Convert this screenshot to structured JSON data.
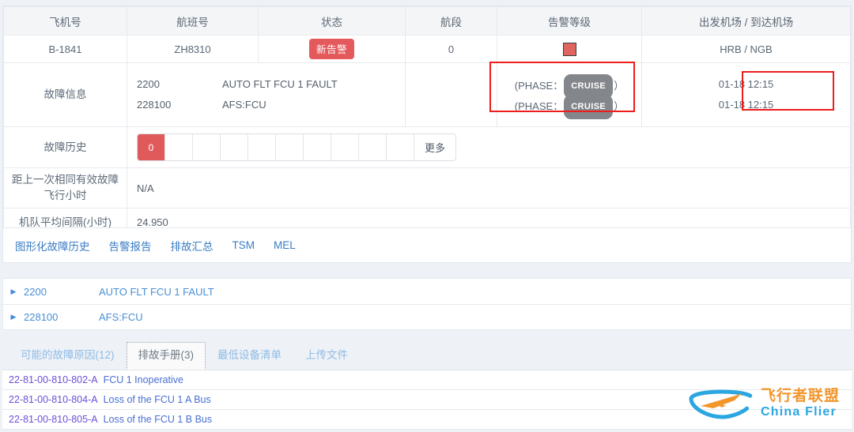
{
  "table": {
    "headers": [
      "飞机号",
      "航班号",
      "状态",
      "航段",
      "告警等级",
      "出发机场 / 到达机场"
    ],
    "main_row": {
      "aircraft": "B-1841",
      "flight": "ZH8310",
      "status_badge": "新告警",
      "leg": "0",
      "alarm_level_icon": "red-square-icon",
      "airports": "HRB / NGB"
    },
    "fault_info": {
      "label": "故障信息",
      "rows": [
        {
          "code": "2200",
          "desc": "AUTO FLT FCU 1 FAULT",
          "phase_prefix": "(PHASE：",
          "phase": "CRUISE",
          "phase_suffix": "）",
          "time": "01-18 12:15"
        },
        {
          "code": "228100",
          "desc": "AFS:FCU",
          "phase_prefix": "(PHASE：",
          "phase": "CRUISE",
          "phase_suffix": "）",
          "time": "01-18 12:15"
        }
      ]
    },
    "fault_history": {
      "label": "故障历史",
      "cells": [
        "0",
        "",
        "",
        "",
        "",
        "",
        "",
        "",
        "",
        ""
      ],
      "filled_index": 0,
      "more_label": "更多"
    },
    "last_same_fault": {
      "label": "距上一次相同有效故障飞行小时",
      "label_line1": "距上一次相同有效故障",
      "label_line2": "飞行小时",
      "value": "N/A"
    },
    "fleet_avg": {
      "label": "机队平均间隔(小时)",
      "value": "24.950"
    }
  },
  "linkbar": {
    "links": [
      "图形化故障历史",
      "告警报告",
      "排故汇总",
      "TSM",
      "MEL"
    ]
  },
  "accordion": {
    "rows": [
      {
        "code": "2200",
        "desc": "AUTO FLT FCU 1 FAULT"
      },
      {
        "code": "228100",
        "desc": "AFS:FCU"
      }
    ]
  },
  "bottom_tabs": {
    "tabs": [
      {
        "label": "可能的故障原因(12)",
        "active": false
      },
      {
        "label": "排故手册(3)",
        "active": true
      },
      {
        "label": "最低设备清单",
        "active": false
      },
      {
        "label": "上传文件",
        "active": false
      }
    ],
    "list": [
      {
        "code": "22-81-00-810-802-A",
        "title": "FCU 1 Inoperative"
      },
      {
        "code": "22-81-00-810-804-A",
        "title": "Loss of the FCU 1 A Bus"
      },
      {
        "code": "22-81-00-810-805-A",
        "title": "Loss of the FCU 1 B Bus"
      }
    ]
  },
  "watermark": {
    "cn": "飞行者联盟",
    "en": "China Flier"
  },
  "colors": {
    "badge_red": "#e4595c",
    "alarm_square": "#e0655f",
    "annotation_red": "#ee1c1c",
    "link_blue": "#3a7cc4",
    "pill_gray": "#83868a",
    "header_bg": "#f4f5f7",
    "page_bg": "#eef2f7"
  }
}
